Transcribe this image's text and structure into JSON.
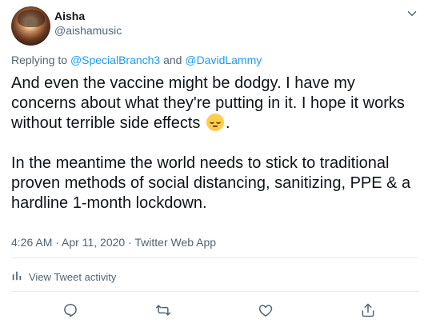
{
  "author": {
    "name": "Aisha",
    "handle": "@aishamusic"
  },
  "reply": {
    "prefix": "Replying to ",
    "mention1": "@SpecialBranch3",
    "joiner": " and ",
    "mention2": "@DavidLammy"
  },
  "tweet": {
    "line1": "And even the vaccine might be dodgy. I have my concerns about what they're putting in it. I hope it works without terrible side effects",
    "line1_end": ".",
    "line2": "In the meantime the world needs to stick to traditional proven methods of social distancing, sanitizing, PPE & a hardline 1-month lockdown."
  },
  "meta": {
    "time": "4:26 AM",
    "dot1": " · ",
    "date": "Apr 11, 2020",
    "dot2": " · ",
    "source": "Twitter Web App"
  },
  "activity": {
    "label": "View Tweet activity"
  },
  "icons": {
    "more": "chevron-down-icon",
    "activity": "bar-chart-icon",
    "reply": "reply-icon",
    "retweet": "retweet-icon",
    "like": "heart-icon",
    "share": "share-icon",
    "emoji": "pensive-face-emoji"
  },
  "colors": {
    "link": "#1d9bf0",
    "muted": "#536471",
    "text": "#0f1419"
  }
}
